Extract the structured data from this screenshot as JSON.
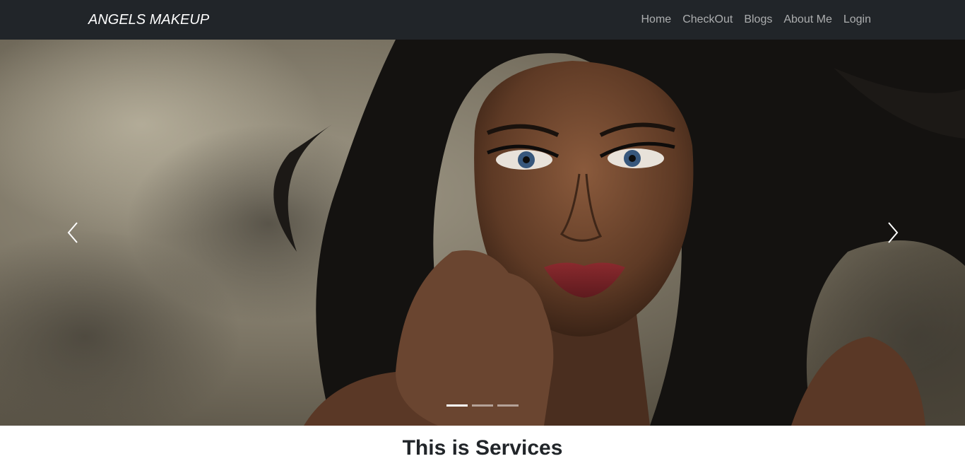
{
  "navbar": {
    "brand": "ANGELS MAKEUP",
    "links": [
      {
        "label": "Home"
      },
      {
        "label": "CheckOut"
      },
      {
        "label": "Blogs"
      },
      {
        "label": "About Me"
      },
      {
        "label": "Login"
      }
    ]
  },
  "carousel": {
    "slide_count": 3,
    "active_index": 0,
    "prev_icon": "chevron-left-icon",
    "next_icon": "chevron-right-icon"
  },
  "services": {
    "heading": "This is Services"
  },
  "colors": {
    "navbar_bg": "#212529",
    "nav_link": "#9ea0a2",
    "brand": "#ffffff"
  }
}
